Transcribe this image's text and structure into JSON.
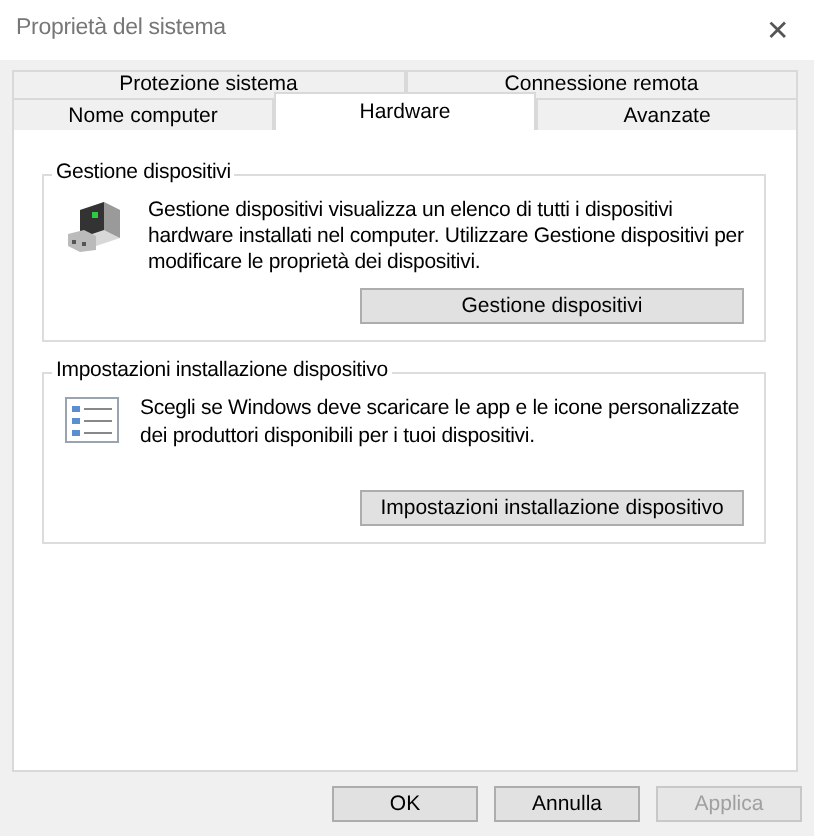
{
  "window": {
    "title": "Proprietà del sistema",
    "close": "✕"
  },
  "tab_rows": [
    [
      {
        "label": "Protezione sistema",
        "selected": false
      },
      {
        "label": "Connessione remota",
        "selected": false
      }
    ],
    [
      {
        "label": "Nome computer",
        "selected": false
      },
      {
        "label": "Hardware",
        "selected": true
      },
      {
        "label": "Avanzate",
        "selected": false
      }
    ]
  ],
  "groups": [
    {
      "title": "Gestione dispositivi",
      "text": "Gestione dispositivi visualizza un elenco di tutti i dispositivi hardware installati nel computer. Utilizzare Gestione dispositivi per modificare le proprietà dei dispositivi.",
      "button": "Gestione dispositivi"
    },
    {
      "title": "Impostazioni installazione dispositivo",
      "text": "Scegli se Windows deve scaricare le app e le icone personalizzate dei produttori disponibili per i tuoi dispositivi.",
      "button": "Impostazioni installazione dispositivo"
    }
  ],
  "buttons": [
    {
      "label": "OK",
      "disabled": false
    },
    {
      "label": "Annulla",
      "disabled": false
    },
    {
      "label": "Applica",
      "disabled": true
    }
  ]
}
